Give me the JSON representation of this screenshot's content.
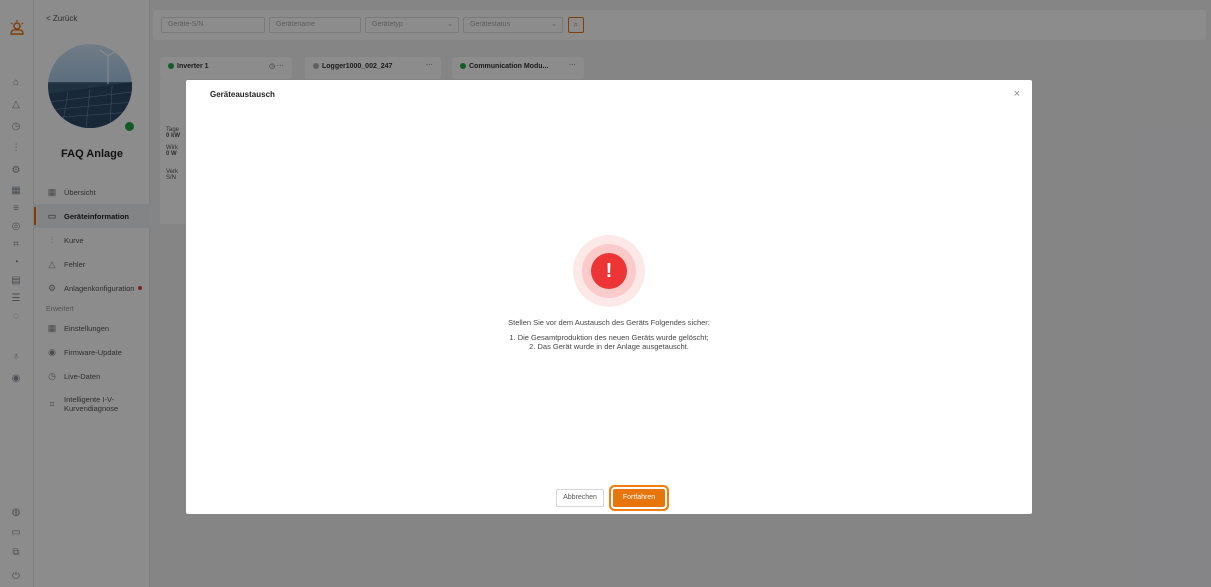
{
  "sidebar": {
    "back_label": "< Zurück",
    "plant_name": "FAQ Anlage",
    "items": [
      {
        "label": "Übersicht",
        "icon": "grid-icon"
      },
      {
        "label": "Geräteinformation",
        "icon": "device-icon"
      },
      {
        "label": "Kurve",
        "icon": "chart-icon"
      },
      {
        "label": "Fehler",
        "icon": "warning-icon"
      },
      {
        "label": "Anlagenkonfiguration",
        "icon": "gear-icon"
      }
    ],
    "section_label": "Erweitert",
    "advanced_items": [
      {
        "label": "Einstellungen",
        "icon": "grid-icon"
      },
      {
        "label": "Firmware-Update",
        "icon": "update-icon"
      },
      {
        "label": "Live-Daten",
        "icon": "clock-icon"
      },
      {
        "label": "Intelligente I-V-Kurvendiagnose",
        "icon": "scan-icon"
      }
    ]
  },
  "filters": {
    "sn_placeholder": "Geräte-S/N",
    "name_placeholder": "Gerätename",
    "type_placeholder": "Gerätetyp",
    "status_placeholder": "Gerätestatus"
  },
  "devices": [
    {
      "name": "Inverter 1",
      "status_color": "#22a84a"
    },
    {
      "name": "Logger1000_002_247",
      "status_color": "#b0b0b0"
    },
    {
      "name": "Communication Modu...",
      "status_color": "#22a84a"
    }
  ],
  "panel_lines": [
    "Tage",
    "0 kW",
    "Wirk",
    "0 W",
    "Verk",
    "S/N"
  ],
  "modal": {
    "title": "Geräteaustausch",
    "close_icon": "×",
    "alert_icon": "!",
    "message": "Stellen Sie vor dem Austausch des Geräts Folgendes sicher:",
    "line1": "1. Die Gesamtproduktion des neuen Geräts wurde gelöscht;",
    "line2": "2. Das Gerät wurde in der Anlage ausgetauscht.",
    "cancel_label": "Abbrechen",
    "continue_label": "Fortfahren"
  },
  "colors": {
    "accent": "#e8740c",
    "danger": "#ee3535",
    "success": "#22a84a"
  }
}
